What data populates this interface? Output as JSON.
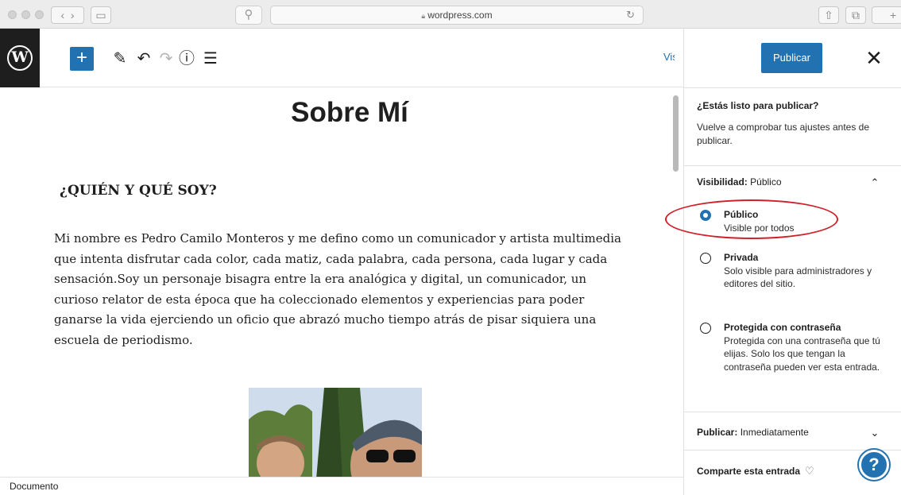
{
  "browser": {
    "url": "wordpress.com",
    "lock_icon": "lock-icon",
    "search_icon": "search-icon",
    "reload_icon": "reload-icon"
  },
  "toolbar": {
    "logo_letter": "W",
    "add_symbol": "+",
    "edit_symbol": "✎",
    "undo_symbol": "↶",
    "redo_symbol": "↷",
    "info_symbol": "ⓘ",
    "outline_symbol": "☰",
    "view_label": "Vista",
    "publish_label": "Publicar",
    "close_symbol": "✕"
  },
  "editor": {
    "title": "Sobre Mí",
    "heading": "¿QUIÉN  Y QUÉ SOY?",
    "paragraph": "Mi nombre es Pedro Camilo Monteros y me defino como un comunicador y artista multimedia que intenta disfrutar cada color, cada matiz, cada palabra, cada persona, cada lugar y cada sensación.Soy un personaje bisagra entre la era analógica y digital, un comunicador, un curioso relator de esta época que ha coleccionado elementos y experiencias para poder ganarse la vida ejerciendo un oficio que abrazó mucho tiempo atrás de pisar siquiera una escuela de periodismo."
  },
  "footer": {
    "label": "Documento"
  },
  "sidebar": {
    "ready_title": "¿Estás listo para publicar?",
    "ready_desc": "Vuelve a comprobar tus ajustes antes de publicar.",
    "visibility": {
      "label": "Visibilidad:",
      "value": "Público",
      "options": [
        {
          "label": "Público",
          "desc": "Visible por todos",
          "selected": true
        },
        {
          "label": "Privada",
          "desc": "Solo visible para administradores y editores del sitio.",
          "selected": false
        },
        {
          "label": "Protegida con contraseña",
          "desc": "Protegida con una contraseña que tú elijas. Solo los que tengan la contraseña pueden ver esta entrada.",
          "selected": false
        }
      ]
    },
    "publish": {
      "label": "Publicar:",
      "value": "Inmediatamente"
    },
    "share": {
      "label": "Comparte esta entrada"
    },
    "help_symbol": "?"
  },
  "colors": {
    "accent": "#2271b1",
    "highlight_ellipse": "#d0202a"
  }
}
